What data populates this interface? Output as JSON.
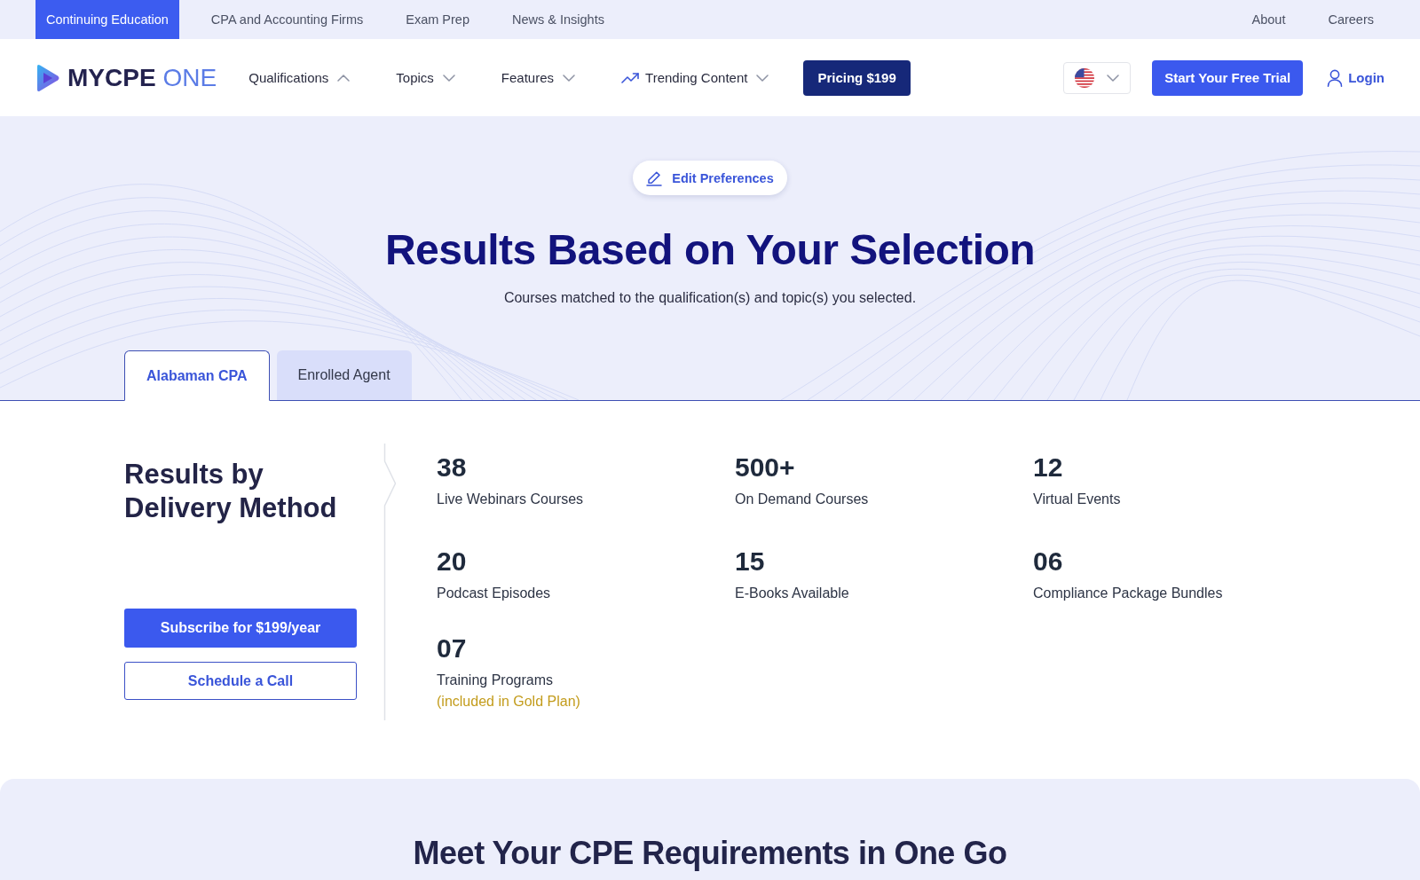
{
  "top_bar": {
    "links": [
      {
        "label": "Continuing Education",
        "selected": true
      },
      {
        "label": "CPA and Accounting Firms",
        "selected": false
      },
      {
        "label": "Exam Prep",
        "selected": false
      },
      {
        "label": "News & Insights",
        "selected": false
      }
    ],
    "right_links": [
      "About",
      "Careers"
    ]
  },
  "header": {
    "logo": {
      "brand": "MYCPE",
      "suffix": "ONE"
    },
    "nav": [
      {
        "label": "Qualifications",
        "kind": "menu",
        "expanded": true
      },
      {
        "label": "Topics",
        "kind": "menu",
        "expanded": false
      },
      {
        "label": "Features",
        "kind": "menu",
        "expanded": false
      },
      {
        "label": "Trending Content",
        "kind": "trending",
        "expanded": false
      }
    ],
    "pricing_button": "Pricing $199",
    "trial_button": "Start Your Free Trial",
    "login": "Login"
  },
  "hero": {
    "edit_button": "Edit Preferences",
    "title": "Results Based on Your Selection",
    "subtitle": "Courses matched to the qualification(s) and topic(s) you selected.",
    "tabs": [
      {
        "label": "Alabaman CPA",
        "selected": true
      },
      {
        "label": "Enrolled Agent",
        "selected": false
      }
    ]
  },
  "results": {
    "title": "Results by Delivery Method",
    "subscribe_button": "Subscribe for $199/year",
    "schedule_button": "Schedule a Call",
    "stats": [
      {
        "value": "38",
        "label": "Live Webinars Courses"
      },
      {
        "value": "500+",
        "label": "On Demand Courses"
      },
      {
        "value": "12",
        "label": "Virtual Events"
      },
      {
        "value": "20",
        "label": "Podcast Episodes"
      },
      {
        "value": "15",
        "label": "E-Books Available"
      },
      {
        "value": "06",
        "label": "Compliance Package Bundles"
      },
      {
        "value": "07",
        "label": "Training Programs",
        "note": "(included in Gold Plan)"
      }
    ]
  },
  "requirements": {
    "title": "Meet Your CPE Requirements in One Go"
  }
}
